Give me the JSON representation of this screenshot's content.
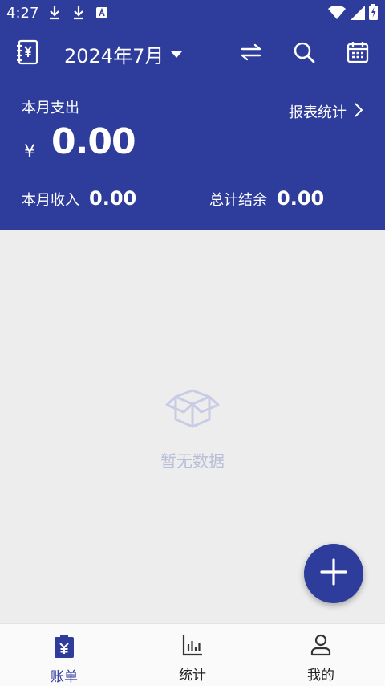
{
  "status_bar": {
    "time": "4:27"
  },
  "toolbar": {
    "month": "2024年7月"
  },
  "summary": {
    "expense_label": "本月支出",
    "report_link": "报表统计",
    "currency": "¥",
    "expense_amount": "0.00",
    "income_label": "本月收入",
    "income_amount": "0.00",
    "balance_label": "总计结余",
    "balance_amount": "0.00"
  },
  "empty_state": {
    "text": "暂无数据"
  },
  "bottom_nav": {
    "items": [
      {
        "label": "账单",
        "icon": "bill-icon",
        "active": true
      },
      {
        "label": "统计",
        "icon": "chart-icon",
        "active": false
      },
      {
        "label": "我的",
        "icon": "person-icon",
        "active": false
      }
    ]
  },
  "colors": {
    "primary": "#2e3c9c",
    "background": "#ededed",
    "muted": "#b9bed8"
  }
}
